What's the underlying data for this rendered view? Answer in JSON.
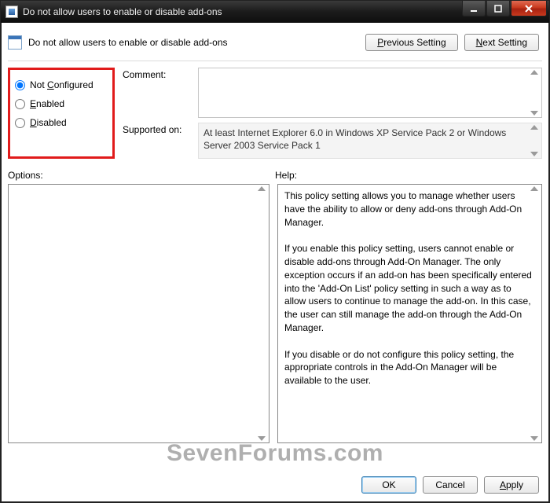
{
  "window": {
    "title": "Do not allow users to enable or disable add-ons"
  },
  "header": {
    "policy_title": "Do not allow users to enable or disable add-ons",
    "prev_btn_pre": "P",
    "prev_btn_post": "revious Setting",
    "next_btn_pre": "N",
    "next_btn_post": "ext Setting"
  },
  "state": {
    "options": [
      {
        "pre": "Not ",
        "ul": "C",
        "post": "onfigured",
        "checked": true
      },
      {
        "pre": "",
        "ul": "E",
        "post": "nabled",
        "checked": false
      },
      {
        "pre": "",
        "ul": "D",
        "post": "isabled",
        "checked": false
      }
    ]
  },
  "fields": {
    "comment_label": "Comment:",
    "comment_value": "",
    "supported_label": "Supported on:",
    "supported_value": "At least Internet Explorer 6.0 in Windows XP Service Pack 2 or Windows Server 2003 Service Pack 1"
  },
  "panels": {
    "options_label": "Options:",
    "help_label": "Help:",
    "help_text": "This policy setting allows you to manage whether users have the ability to allow or deny add-ons through Add-On Manager.\n\nIf you enable this policy setting, users cannot enable or disable add-ons through Add-On Manager. The only exception occurs if an add-on has been specifically entered into the 'Add-On List' policy setting in such a way as to allow users to continue to manage the add-on. In this case, the user can still manage the add-on through the Add-On Manager.\n\nIf you disable or do not configure this policy setting, the appropriate controls in the Add-On Manager will be available to the user."
  },
  "buttons": {
    "ok": "OK",
    "cancel": "Cancel",
    "apply_pre": "A",
    "apply_post": "pply"
  },
  "watermark": "SevenForums.com"
}
